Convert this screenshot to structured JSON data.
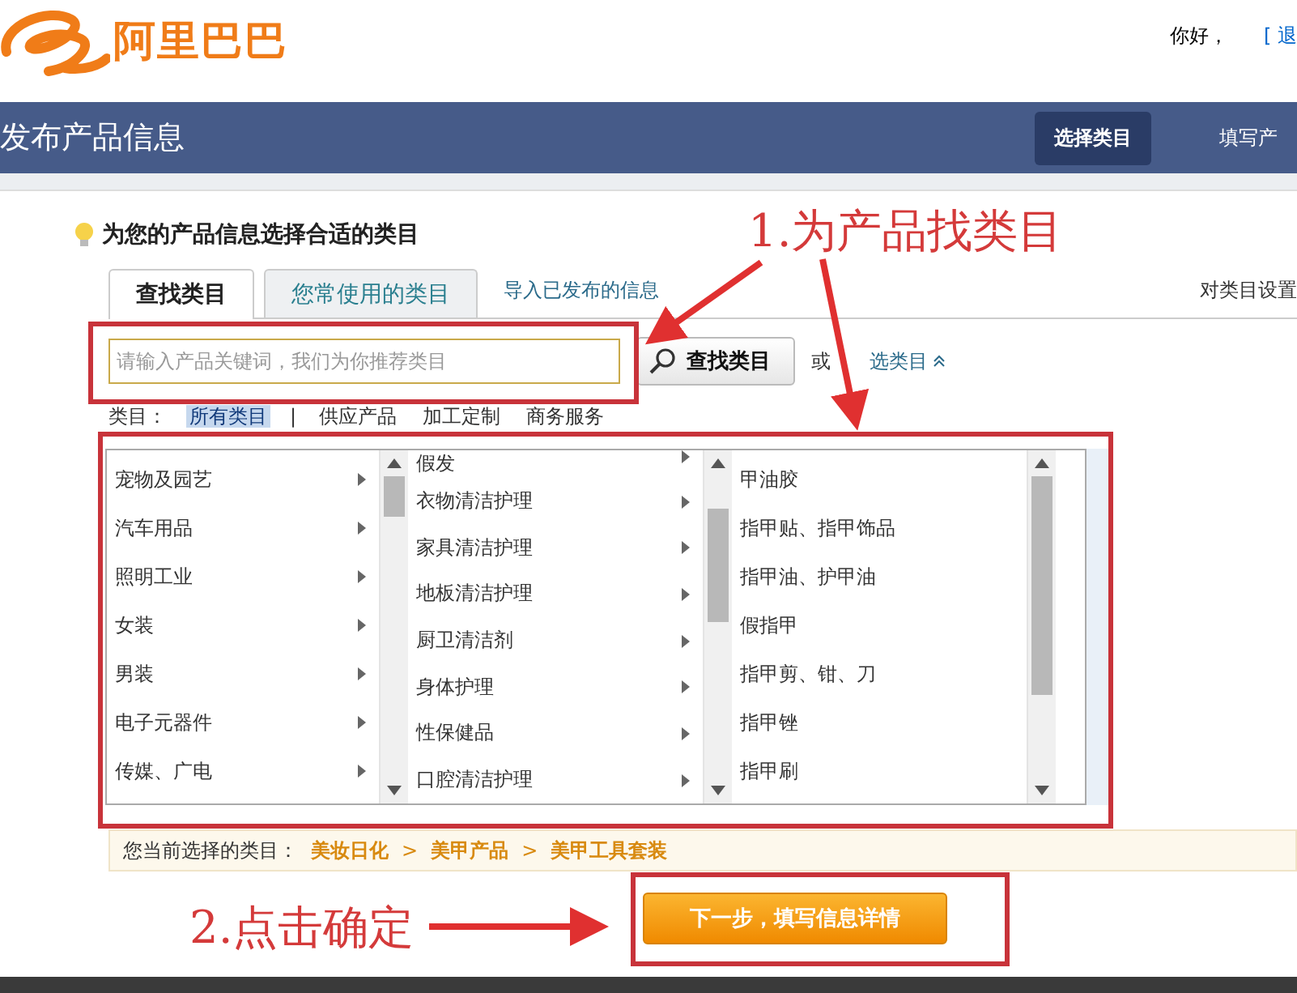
{
  "header": {
    "logo_text": "阿里巴巴",
    "greeting": "你好，",
    "logout": "[ 退"
  },
  "title_bar": {
    "title": "发布产品信息",
    "steps": [
      {
        "label": "选择类目",
        "selected": true
      },
      {
        "label": "填写产",
        "selected": false
      }
    ]
  },
  "hint": "为您的产品信息选择合适的类目",
  "tabs": [
    {
      "label": "查找类目",
      "selected": true
    },
    {
      "label": "您常使用的类目",
      "selected": false
    }
  ],
  "import_link": "导入已发布的信息",
  "settings_link": "对类目设置",
  "search": {
    "placeholder": "请输入产品关键词，我们为你推荐类目",
    "button": "查找类目",
    "or": "或",
    "browse": "选类目"
  },
  "filter": {
    "label": "类目：",
    "items": [
      {
        "label": "所有类目",
        "selected": true
      },
      {
        "label": "供应产品",
        "selected": false
      },
      {
        "label": "加工定制",
        "selected": false
      },
      {
        "label": "商务服务",
        "selected": false
      }
    ],
    "separator": "|"
  },
  "columns": [
    {
      "expandable": true,
      "items": [
        "宠物及园艺",
        "汽车用品",
        "照明工业",
        "女装",
        "男装",
        "电子元器件",
        "传媒、广电"
      ]
    },
    {
      "expandable": true,
      "items": [
        "假发",
        "衣物清洁护理",
        "家具清洁护理",
        "地板清洁护理",
        "厨卫清洁剂",
        "身体护理",
        "性保健品",
        "口腔清洁护理"
      ]
    },
    {
      "expandable": false,
      "items": [
        "甲油胶",
        "指甲贴、指甲饰品",
        "指甲油、护甲油",
        "假指甲",
        "指甲剪、钳、刀",
        "指甲锉",
        "指甲刷"
      ]
    }
  ],
  "selected_path": {
    "label": "您当前选择的类目：",
    "crumbs": [
      "美妆日化",
      "美甲产品",
      "美甲工具套装"
    ],
    "separator": ">"
  },
  "next_button": "下一步，填写信息详情",
  "annotations": [
    "1.为产品找类目",
    "2.点击确定"
  ]
}
